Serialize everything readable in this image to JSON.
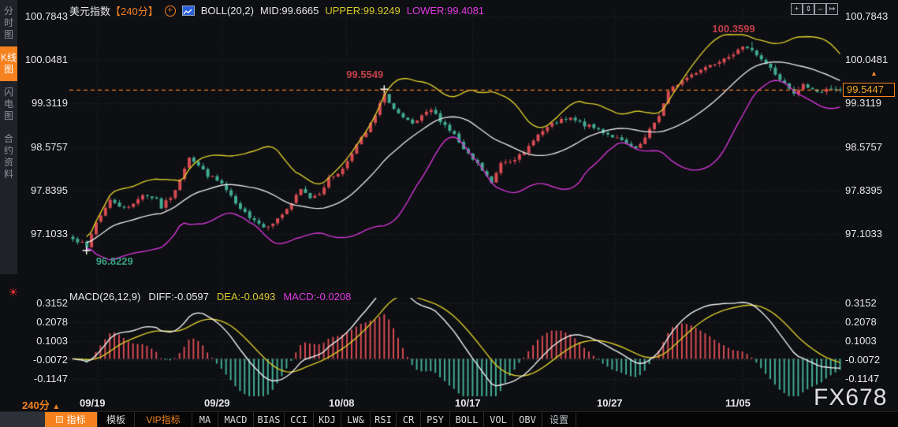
{
  "header": {
    "symbol": "美元指数",
    "period_tag": "【240分】",
    "boll_label": "BOLL(20,2)",
    "mid_label": "MID:99.6665",
    "upper_label": "UPPER:99.9249",
    "lower_label": "LOWER:99.4081"
  },
  "sidebar": {
    "items": [
      {
        "label": "分时图",
        "active": false
      },
      {
        "label": "K线图",
        "active": true
      },
      {
        "label": "闪电图",
        "active": false
      },
      {
        "label": "合约资料",
        "active": false
      }
    ]
  },
  "top_toolbar": {
    "icons": [
      {
        "name": "crosshair-icon",
        "glyph": "+"
      },
      {
        "name": "y-axis-zoom-icon",
        "glyph": "⇕"
      },
      {
        "name": "x-axis-zoom-icon",
        "glyph": "⇔"
      },
      {
        "name": "pan-icon",
        "glyph": "↦"
      }
    ]
  },
  "price_axis": {
    "labels": [
      "100.7843",
      "100.0481",
      "99.3119",
      "98.5757",
      "97.8395",
      "97.1033"
    ],
    "values": [
      100.7843,
      100.0481,
      99.3119,
      98.5757,
      97.8395,
      97.1033
    ],
    "y": [
      21,
      76,
      131,
      187,
      242,
      297
    ]
  },
  "macd_axis": {
    "labels": [
      "0.3152",
      "0.2078",
      "0.1003",
      "-0.0072",
      "-0.1147"
    ],
    "values": [
      0.3152,
      0.2078,
      0.1003,
      -0.0072,
      -0.1147
    ],
    "y": [
      385,
      409,
      433,
      457,
      481
    ]
  },
  "x_axis": {
    "labels": [
      "09/19",
      "09/29",
      "10/08",
      "10/17",
      "10/27",
      "11/05"
    ],
    "x": [
      123,
      281,
      439,
      599,
      779,
      942
    ]
  },
  "macd_header": {
    "title": "MACD(26,12,9)",
    "diff": "DIFF:-0.0597",
    "dea": "DEA:-0.0493",
    "macd": "MACD:-0.0208"
  },
  "annotations": {
    "swing_high": "99.5549",
    "high": "100.3599",
    "low": "96.8229",
    "last_price": "99.5447"
  },
  "period_selector": {
    "label": "240分",
    "arrow": "▲"
  },
  "watermark": "FX678",
  "bottom_toolbar": {
    "items": [
      {
        "label": "指标",
        "state": "selected",
        "cn": true
      },
      {
        "label": "模板",
        "cn": true
      },
      {
        "label": "VIP指标",
        "state": "vip",
        "cn": true
      },
      {
        "label": "MA"
      },
      {
        "label": "MACD"
      },
      {
        "label": "BIAS"
      },
      {
        "label": "CCI"
      },
      {
        "label": "KDJ"
      },
      {
        "label": "LW&"
      },
      {
        "label": "RSI"
      },
      {
        "label": "CR"
      },
      {
        "label": "PSY"
      },
      {
        "label": "BOLL"
      },
      {
        "label": "VOL"
      },
      {
        "label": "OBV"
      },
      {
        "label": "设置",
        "state": "dim",
        "cn": true
      }
    ]
  },
  "colors": {
    "bg": "#0d0f13",
    "panel": "#202229",
    "grid": "#2a2d34",
    "accent": "#f5821f",
    "up": "#d64b52",
    "down": "#41ac92",
    "boll_upper": "#d8ca2a",
    "boll_mid": "#e2e2e2",
    "boll_lower": "#d335d3",
    "annotation_red": "#c24048",
    "annotation_teal": "#3aa182",
    "price_line": "#f07c1e",
    "zero_line": "#777777"
  },
  "chart_data": {
    "type": "candlestick_with_boll_macd",
    "symbol": "美元指数",
    "period": "240分",
    "n_bars": 166,
    "dates": [
      "09/19",
      "09/29",
      "10/08",
      "10/17",
      "10/27",
      "11/05"
    ],
    "price_gridlines": [
      100.7843,
      100.0481,
      99.3119,
      98.5757,
      97.8395,
      97.1033
    ],
    "macd_gridlines": [
      0.3152,
      0.2078,
      0.1003,
      -0.0072,
      -0.1147
    ],
    "close_anchors": [
      [
        0,
        97.05
      ],
      [
        3,
        96.88
      ],
      [
        5,
        97.3
      ],
      [
        7,
        97.55
      ],
      [
        8,
        97.7
      ],
      [
        10,
        97.55
      ],
      [
        13,
        97.6
      ],
      [
        15,
        97.78
      ],
      [
        18,
        97.7
      ],
      [
        19,
        97.55
      ],
      [
        22,
        97.82
      ],
      [
        23,
        98.05
      ],
      [
        25,
        98.42
      ],
      [
        27,
        98.26
      ],
      [
        29,
        98.1
      ],
      [
        32,
        97.95
      ],
      [
        34,
        97.72
      ],
      [
        36,
        97.5
      ],
      [
        39,
        97.36
      ],
      [
        41,
        97.22
      ],
      [
        44,
        97.35
      ],
      [
        47,
        97.62
      ],
      [
        49,
        97.85
      ],
      [
        51,
        97.72
      ],
      [
        53,
        97.8
      ],
      [
        55,
        98.03
      ],
      [
        58,
        98.2
      ],
      [
        60,
        98.5
      ],
      [
        63,
        98.82
      ],
      [
        65,
        99.1
      ],
      [
        67,
        99.48
      ],
      [
        69,
        99.22
      ],
      [
        71,
        99.05
      ],
      [
        73,
        98.95
      ],
      [
        75,
        99.08
      ],
      [
        77,
        99.2
      ],
      [
        79,
        99.03
      ],
      [
        82,
        98.78
      ],
      [
        84,
        98.52
      ],
      [
        87,
        98.28
      ],
      [
        89,
        98.08
      ],
      [
        90,
        97.95
      ],
      [
        92,
        98.32
      ],
      [
        94,
        98.36
      ],
      [
        97,
        98.45
      ],
      [
        99,
        98.72
      ],
      [
        102,
        98.9
      ],
      [
        104,
        99.0
      ],
      [
        107,
        99.05
      ],
      [
        110,
        98.95
      ],
      [
        113,
        98.87
      ],
      [
        116,
        98.76
      ],
      [
        119,
        98.62
      ],
      [
        121,
        98.52
      ],
      [
        123,
        98.72
      ],
      [
        126,
        99.12
      ],
      [
        128,
        99.5
      ],
      [
        130,
        99.65
      ],
      [
        133,
        99.8
      ],
      [
        135,
        99.9
      ],
      [
        138,
        100.0
      ],
      [
        140,
        100.1
      ],
      [
        143,
        100.2
      ],
      [
        145,
        100.28
      ],
      [
        147,
        100.15
      ],
      [
        150,
        99.9
      ],
      [
        152,
        99.72
      ],
      [
        155,
        99.46
      ],
      [
        157,
        99.62
      ],
      [
        159,
        99.55
      ],
      [
        161,
        99.5
      ],
      [
        163,
        99.58
      ],
      [
        165,
        99.5447
      ]
    ],
    "key_points": {
      "low": {
        "index": 3,
        "price": 96.8229
      },
      "swing_high": {
        "index": 67,
        "price": 99.5549
      },
      "high": {
        "index": 146,
        "price": 100.3599
      },
      "last_close": 99.5447
    },
    "boll": {
      "period": 20,
      "k": 2,
      "mid": 99.6665,
      "upper": 99.9249,
      "lower": 99.4081
    },
    "macd": {
      "fast": 12,
      "slow": 26,
      "signal": 9,
      "diff": -0.0597,
      "dea": -0.0493,
      "bar": -0.0208
    }
  }
}
